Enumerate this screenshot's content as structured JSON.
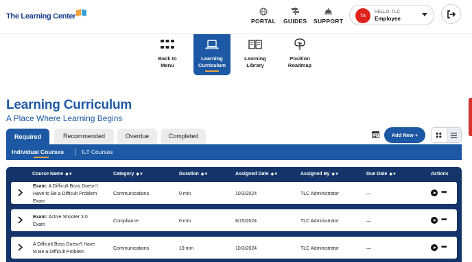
{
  "header": {
    "logo_main": "The Learning ",
    "logo_accent": "Center",
    "nav": [
      {
        "label": "PORTAL",
        "icon": "globe-icon"
      },
      {
        "label": "GUIDES",
        "icon": "signpost-icon"
      },
      {
        "label": "SUPPORT",
        "icon": "support-bell-icon"
      }
    ],
    "user": {
      "initials": "TA",
      "greeting": "HELLO, TLC",
      "role": "Employee"
    },
    "logout_icon": "logout-icon"
  },
  "subnav": [
    {
      "line1": "Back to",
      "line2": "Menu",
      "icon": "grid-icon"
    },
    {
      "line1": "Learning",
      "line2": "Curriculum",
      "icon": "laptop-icon",
      "active": true
    },
    {
      "line1": "Learning",
      "line2": "Library",
      "icon": "book-icon"
    },
    {
      "line1": "Position",
      "line2": "Roadmap",
      "icon": "tree-icon"
    }
  ],
  "page": {
    "title": "Learning Curriculum",
    "subtitle": "A Place Where Learning Begins"
  },
  "tabs": [
    "Required",
    "Recommended",
    "Overdue",
    "Completed"
  ],
  "add_new_label": "Add New +",
  "subtabs": [
    "Individual Courses",
    "ILT Courses"
  ],
  "table": {
    "columns": [
      "Course Name",
      "Category",
      "Duration",
      "Assigned Date",
      "Assigned By",
      "Due Date",
      "Actions"
    ],
    "rows": [
      {
        "prefix": "Exam:",
        "name_l1": " A Difficult Boss Doesn't",
        "name_l2": "Have to Be a Difficult Problem",
        "name_l3": "Exam",
        "category": "Communications",
        "duration": "0 min",
        "assigned_date": "10/3/2024",
        "assigned_by": "TLC Administrator",
        "due_date": "—"
      },
      {
        "prefix": "Exam:",
        "name_l1": " Active Shooter 3.0",
        "name_l2": "Exam",
        "name_l3": "",
        "category": "Compliance",
        "duration": "0 min",
        "assigned_date": "8/15/2024",
        "assigned_by": "TLC Administrator",
        "due_date": "—"
      },
      {
        "prefix": "",
        "name_l1": "A Difficult Boss Doesn't Have",
        "name_l2": "to Be a Difficult Problem",
        "name_l3": "",
        "category": "Communications",
        "duration": "19 min",
        "assigned_date": "10/3/2024",
        "assigned_by": "TLC Administrator",
        "due_date": "—"
      }
    ]
  },
  "colors": {
    "primary": "#1c58a3",
    "table_header": "#15356a",
    "accent_orange": "#f2a33a",
    "avatar_red": "#e0221d"
  }
}
